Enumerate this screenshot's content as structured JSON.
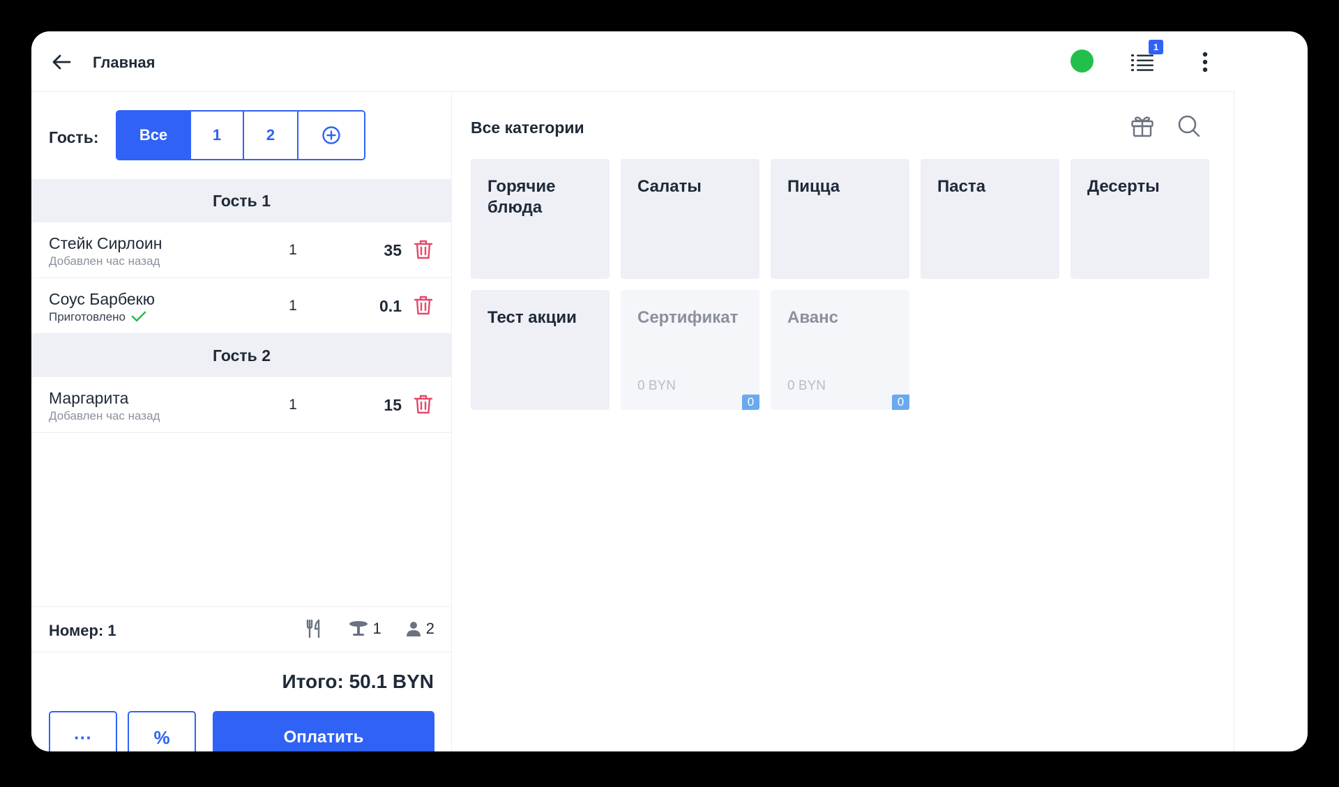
{
  "header": {
    "title": "Главная",
    "status_color": "#22c04a",
    "orders_badge": "1"
  },
  "left": {
    "guest_label": "Гость:",
    "guest_tabs": [
      {
        "label": "Все",
        "active": true
      },
      {
        "label": "1"
      },
      {
        "label": "2"
      },
      {
        "label": "add-guest-icon"
      }
    ],
    "groups": [
      {
        "title": "Гость 1",
        "items": [
          {
            "name": "Стейк Сирлоин",
            "status": "Добавлен час назад",
            "qty": "1",
            "price": "35"
          },
          {
            "name": "Соус Барбекю",
            "status": "Приготовлено",
            "done": true,
            "qty": "1",
            "price": "0.1"
          }
        ]
      },
      {
        "title": "Гость 2",
        "items": [
          {
            "name": "Маргарита",
            "status": "Добавлен час назад",
            "qty": "1",
            "price": "15"
          }
        ]
      }
    ],
    "number": "Номер: 1",
    "table_count": "1",
    "guest_count": "2",
    "total": "Итого: 50.1 BYN",
    "more_label": "···",
    "discount_label": "%",
    "pay_label": "Оплатить"
  },
  "right": {
    "title": "Все категории",
    "categories": [
      {
        "name": "Горячие блюда"
      },
      {
        "name": "Салаты"
      },
      {
        "name": "Пицца"
      },
      {
        "name": "Паста"
      },
      {
        "name": "Десерты"
      },
      {
        "name": "Тест акции"
      },
      {
        "name": "Сертификат",
        "amount": "0 BYN",
        "badge": "0",
        "faded": true
      },
      {
        "name": "Аванс",
        "amount": "0 BYN",
        "badge": "0",
        "faded": true
      }
    ]
  },
  "colors": {
    "accent": "#2f62f5",
    "danger": "#e5486b",
    "success": "#22c04a",
    "badge": "#6aa9ef"
  },
  "icons": [
    "arrow-left-icon",
    "list-icon",
    "more-vertical-icon",
    "add-guest-icon",
    "trash-icon",
    "check-icon",
    "cutlery-icon",
    "table-icon",
    "person-icon",
    "gift-icon",
    "search-icon"
  ]
}
